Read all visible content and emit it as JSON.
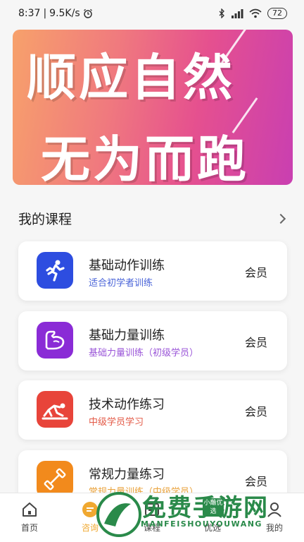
{
  "status": {
    "time": "8:37",
    "speed": "9.5K/s",
    "battery": "72"
  },
  "banner": {
    "line1": "顺应自然",
    "line2": "无为而跑"
  },
  "section": {
    "title": "我的课程"
  },
  "courses": [
    {
      "title": "基础动作训练",
      "subtitle": "适合初学者训练",
      "badge": "会员",
      "icon": "running-person-icon",
      "color": "#2d4de0",
      "sub_color": "#4a64d8"
    },
    {
      "title": "基础力量训练",
      "subtitle": "基础力量训练（初级学员）",
      "badge": "会员",
      "icon": "flexed-arm-icon",
      "color": "#8a2bd6",
      "sub_color": "#9a55d8"
    },
    {
      "title": "技术动作练习",
      "subtitle": "中级学员学习",
      "badge": "会员",
      "icon": "sprint-start-icon",
      "color": "#e8443a",
      "sub_color": "#e35a47"
    },
    {
      "title": "常规力量练习",
      "subtitle": "常规力量训练（中级学员）",
      "badge": "会员",
      "icon": "dumbbell-icon",
      "color": "#f28a1c",
      "sub_color": "#e9a23b"
    }
  ],
  "tabs": [
    {
      "label": "首页",
      "icon": "home-icon"
    },
    {
      "label": "咨询",
      "icon": "chat-icon"
    },
    {
      "label": "课程",
      "icon": "course-icon"
    },
    {
      "label": "优选",
      "icon": "select-icon"
    },
    {
      "label": "我的",
      "icon": "profile-icon"
    }
  ],
  "watermark": {
    "text": "免费手游网",
    "sub": "MANFEISHOUYOUWANG",
    "badge": "小蘸优选"
  }
}
